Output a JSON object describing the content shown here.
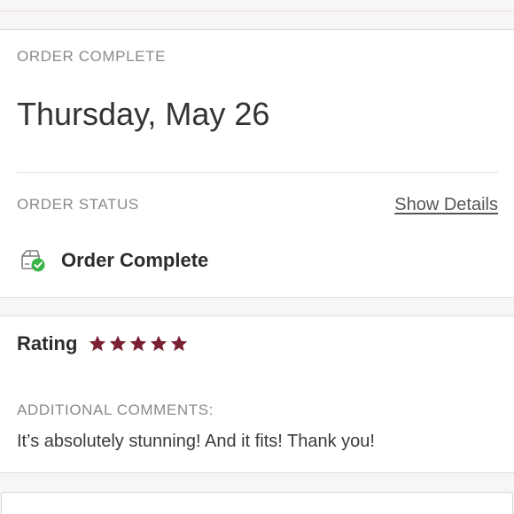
{
  "order": {
    "eyebrow": "ORDER COMPLETE",
    "date": "Thursday, May 26",
    "status_eyebrow": "ORDER STATUS",
    "show_details": "Show Details",
    "status_text": "Order Complete",
    "status_icon": "box-check-icon"
  },
  "rating": {
    "label": "Rating",
    "stars": 5,
    "max_stars": 5,
    "star_color": "#7b1f33",
    "comments_eyebrow": "ADDITIONAL COMMENTS:",
    "comment": "It’s absolutely stunning! And it fits! Thank you!"
  },
  "colors": {
    "background": "#f8f5f5",
    "card": "#ffffff",
    "check_green": "#3bb54a"
  }
}
